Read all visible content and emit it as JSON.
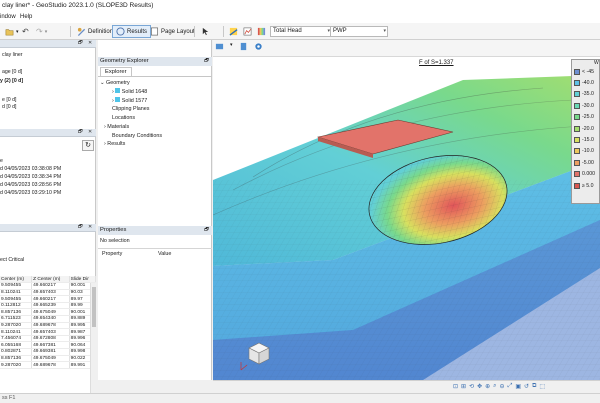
{
  "window": {
    "title": "clay liner* - GeoStudio 2023.1.0 (SLOPE3D Results)"
  },
  "menu": {
    "items": [
      "indow",
      "Help"
    ]
  },
  "toolbar": {
    "definition_label": "Definition",
    "results_label": "Results",
    "page_layout_label": "Page Layout",
    "result_type": "Total Head",
    "result_field": "PWP"
  },
  "left_panel": {
    "analysis_lines": [
      "clay liner",
      "",
      "age [0 d]",
      "y (2) [0 d]",
      "",
      "e [0 d]",
      "d [0 d]"
    ],
    "log_lines": [
      "e",
      "d 04/05/2023 03:38:08 PM",
      "d 04/05/2023 03:38:34 PM",
      "d 04/05/2023 03:28:56 PM",
      "d 04/05/2023 03:29:10 PM"
    ],
    "critical_label": "ect Critical",
    "table": {
      "headers": [
        "Center (m)",
        "Z Center (m)",
        "Slide Dir"
      ],
      "rows": [
        [
          "9.509455",
          "49.660217",
          "90.001"
        ],
        [
          "8.110241",
          "49.657403",
          "90.03"
        ],
        [
          "9.509455",
          "49.660217",
          "89.97"
        ],
        [
          "0.112812",
          "49.665239",
          "89.99"
        ],
        [
          "8.857136",
          "49.675049",
          "90.001"
        ],
        [
          "6.711523",
          "49.654340",
          "89.889"
        ],
        [
          "9.287020",
          "49.689678",
          "89.995"
        ],
        [
          "8.110241",
          "49.657403",
          "89.987"
        ],
        [
          "7.456074",
          "49.672808",
          "89.996"
        ],
        [
          "6.055168",
          "49.667381",
          "90.064"
        ],
        [
          "0.802871",
          "49.669381",
          "89.998"
        ],
        [
          "8.857136",
          "49.675049",
          "90.022"
        ],
        [
          "9.287020",
          "49.689678",
          "89.991"
        ]
      ]
    }
  },
  "geometry_explorer": {
    "title": "Geometry Explorer",
    "tab": "Explorer",
    "items": [
      "Geometry",
      "Solid 1648",
      "Solid 1577",
      "Clipping Planes",
      "Locations",
      "Materials",
      "Boundary Conditions",
      "Results"
    ]
  },
  "properties": {
    "title": "Properties",
    "selection": "No selection",
    "col_property": "Property",
    "col_value": "Value"
  },
  "view": {
    "fos_label": "F of S=1.337",
    "legend_title": "W",
    "legend": [
      {
        "label": "< -45",
        "color": "#6e8fd2"
      },
      {
        "label": "-40.0",
        "color": "#5fc0e6"
      },
      {
        "label": "-35.0",
        "color": "#62cfd6"
      },
      {
        "label": "-30.0",
        "color": "#6ad8b6"
      },
      {
        "label": "-25.0",
        "color": "#79d98c"
      },
      {
        "label": "-20.0",
        "color": "#a5de6e"
      },
      {
        "label": "-15.0",
        "color": "#d8e05f"
      },
      {
        "label": "-10.0",
        "color": "#ecc85c"
      },
      {
        "label": "-5.00",
        "color": "#ec9e60"
      },
      {
        "label": "0.000",
        "color": "#e2736a"
      },
      {
        "label": "≥ 5.0",
        "color": "#d9564f"
      }
    ]
  },
  "status": {
    "text": "ss F1"
  }
}
